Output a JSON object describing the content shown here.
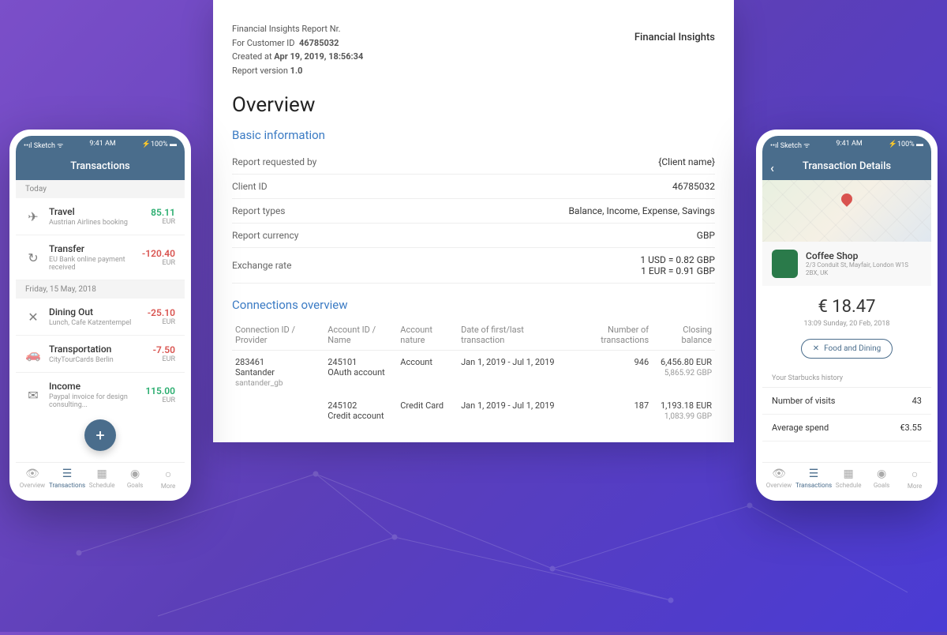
{
  "document": {
    "meta_line1": "Financial Insights Report Nr.",
    "meta_line2_label": "For Customer ID",
    "customer_id": "46785032",
    "meta_line3_label": "Created at",
    "created_at": "Apr 19, 2019, 18:56:34",
    "meta_line4_label": "Report version",
    "version": "1.0",
    "brand": "Financial Insights",
    "title": "Overview",
    "section_basic": "Basic information",
    "basic_rows": [
      {
        "label": "Report requested by",
        "value": "{Client name}"
      },
      {
        "label": "Client ID",
        "value": "46785032"
      },
      {
        "label": "Report types",
        "value": "Balance, Income, Expense, Savings"
      },
      {
        "label": "Report currency",
        "value": "GBP"
      },
      {
        "label": "Exchange rate",
        "value": "1 USD = 0.82 GBP\n1 EUR = 0.91 GBP"
      }
    ],
    "section_conn": "Connections overview",
    "conn_headers": [
      "Connection ID / Provider",
      "Account ID / Name",
      "Account nature",
      "Date of first/last transaction",
      "Number of transactions",
      "Closing balance"
    ],
    "conn_rows": [
      {
        "conn": "283461",
        "provider": "Santander",
        "slug": "santander_gb",
        "acct": "245101",
        "acct_name": "OAuth account",
        "nature": "Account",
        "dates": "Jan 1, 2019 - Jul 1, 2019",
        "count": "946",
        "bal1": "6,456.80  EUR",
        "bal2": "5,865.92  GBP"
      },
      {
        "conn": "",
        "provider": "",
        "slug": "",
        "acct": "245102",
        "acct_name": "Credit account",
        "nature": "Credit Card",
        "dates": "Jan 1, 2019 - Jul 1, 2019",
        "count": "187",
        "bal1": "1,193.18  EUR",
        "bal2": "1,083.99  GBP"
      }
    ]
  },
  "phoneL": {
    "status": {
      "carrier": "Sketch",
      "time": "9:41 AM",
      "battery": "100%"
    },
    "header": "Transactions",
    "sections": [
      {
        "label": "Today",
        "rows": [
          {
            "icon": "✈",
            "title": "Travel",
            "sub": "Austrian Airlines booking",
            "amount": "85.11",
            "cur": "EUR",
            "cls": "pos"
          },
          {
            "icon": "↻",
            "title": "Transfer",
            "sub": "EU Bank online payment received",
            "amount": "-120.40",
            "cur": "EUR",
            "cls": "neg"
          }
        ]
      },
      {
        "label": "Friday, 15 May, 2018",
        "rows": [
          {
            "icon": "✕",
            "title": "Dining Out",
            "sub": "Lunch, Cafe Katzentempel",
            "amount": "-25.10",
            "cur": "EUR",
            "cls": "neg"
          },
          {
            "icon": "🚗",
            "title": "Transportation",
            "sub": "CityTourCards Berlin",
            "amount": "-7.50",
            "cur": "EUR",
            "cls": "neg"
          },
          {
            "icon": "✉",
            "title": "Income",
            "sub": "Paypal invoice for design consulting...",
            "amount": "115.00",
            "cur": "EUR",
            "cls": "pos"
          }
        ]
      }
    ],
    "nav": [
      {
        "icon": "👁",
        "label": "Overview"
      },
      {
        "icon": "☰",
        "label": "Transactions",
        "active": true
      },
      {
        "icon": "▦",
        "label": "Schedule"
      },
      {
        "icon": "◉",
        "label": "Goals"
      },
      {
        "icon": "○",
        "label": "More"
      }
    ],
    "fab": "+"
  },
  "phoneR": {
    "status": {
      "carrier": "Sketch",
      "time": "9:41 AM",
      "battery": "100%"
    },
    "header": "Transaction Details",
    "merchant": {
      "name": "Coffee Shop",
      "addr": "2/3 Conduit St, Mayfair, London W1S 2BX, UK"
    },
    "amount": "€ 18.47",
    "date": "13:09 Sunday, 20 Feb, 2018",
    "category": "Food and Dining",
    "history_label": "Your Starbucks history",
    "history": [
      {
        "label": "Number of visits",
        "value": "43"
      },
      {
        "label": "Average spend",
        "value": "€3.55"
      }
    ],
    "nav": [
      {
        "icon": "👁",
        "label": "Overview"
      },
      {
        "icon": "☰",
        "label": "Transactions",
        "active": true
      },
      {
        "icon": "▦",
        "label": "Schedule"
      },
      {
        "icon": "◉",
        "label": "Goals"
      },
      {
        "icon": "○",
        "label": "More"
      }
    ]
  }
}
